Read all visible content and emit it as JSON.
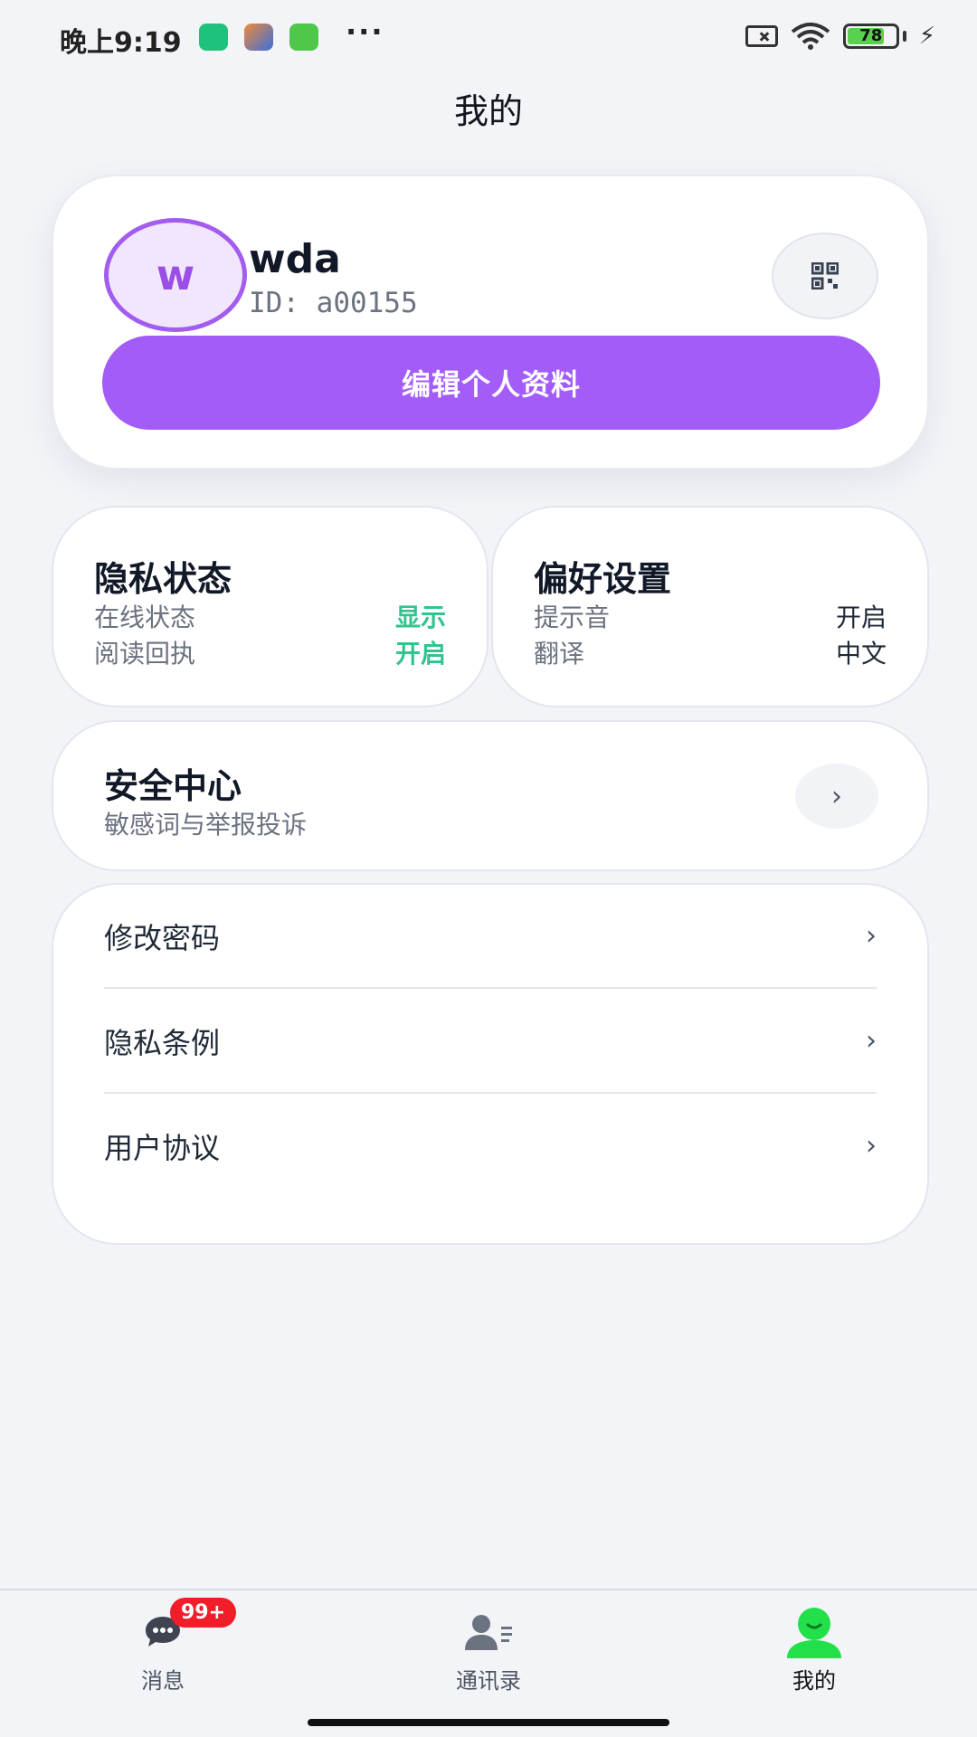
{
  "status_bar": {
    "time": "晚上9:19",
    "battery": "78",
    "more": "···"
  },
  "header": {
    "title": "我的"
  },
  "profile": {
    "avatar_letter": "w",
    "username": "wda",
    "user_id": "ID: a00155",
    "edit_button": "编辑个人资料"
  },
  "privacy": {
    "title": "隐私状态",
    "rows": [
      {
        "label": "在线状态",
        "value": "显示"
      },
      {
        "label": "阅读回执",
        "value": "开启"
      }
    ]
  },
  "preferences": {
    "title": "偏好设置",
    "rows": [
      {
        "label": "提示音",
        "value": "开启"
      },
      {
        "label": "翻译",
        "value": "中文"
      }
    ]
  },
  "security": {
    "title": "安全中心",
    "subtitle": "敏感词与举报投诉",
    "arrow": "›"
  },
  "menu": {
    "items": [
      {
        "label": "修改密码",
        "arrow": "›"
      },
      {
        "label": "隐私条例",
        "arrow": "›"
      },
      {
        "label": "用户协议",
        "arrow": "›"
      }
    ]
  },
  "bottom_nav": {
    "items": [
      {
        "label": "消息",
        "icon": "chat-bubble-icon",
        "badge": "99+"
      },
      {
        "label": "通讯录",
        "icon": "contacts-icon"
      },
      {
        "label": "我的",
        "icon": "profile-icon",
        "active": true
      }
    ]
  },
  "colors": {
    "accent_purple": "#a35cf7",
    "status_green": "#34c38f",
    "badge_red": "#f11d28",
    "nav_active_green": "#22e04a"
  }
}
